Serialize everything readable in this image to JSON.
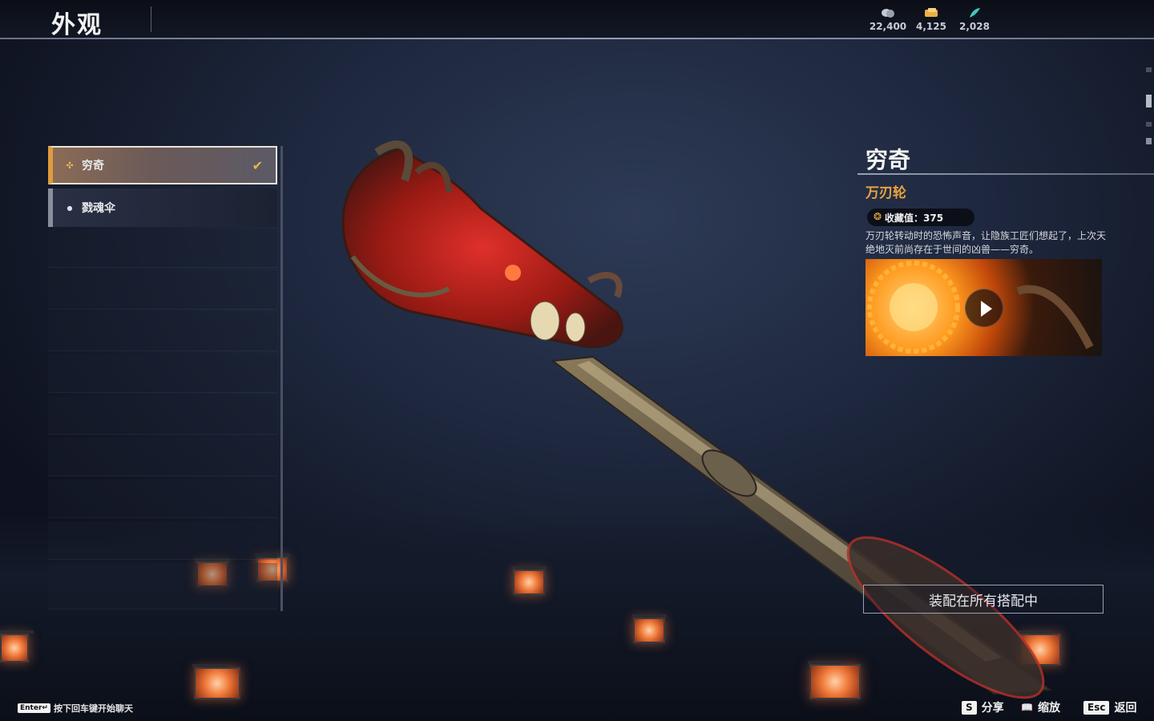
{
  "header": {
    "title": "外观",
    "currencies": [
      {
        "icon": "coin-stack-icon",
        "value": "22,400"
      },
      {
        "icon": "gold-ticket-icon",
        "value": "4,125"
      },
      {
        "icon": "jade-feather-icon",
        "value": "2,028"
      }
    ]
  },
  "sidebar": {
    "items": [
      {
        "label": "穷奇",
        "icon": "dragon-emblem-icon",
        "selected": true
      },
      {
        "label": "戮魂伞",
        "icon": "dot-icon",
        "selected": false
      }
    ]
  },
  "detail": {
    "name": "穷奇",
    "type": "万刃轮",
    "collection_label": "收藏值：375",
    "description": "万刃轮转动时的恐怖声音，让隐族工匠们想起了，上次天绝地灭前尚存在于世间的凶兽——穷奇。",
    "video_icon": "play-icon",
    "equip_label": "装配在所有搭配中"
  },
  "footer": {
    "chat_key": "Enter↵",
    "chat_label": "按下回车键开始聊天",
    "hints": [
      {
        "key": "S",
        "label": "分享"
      },
      {
        "key": "📖",
        "label": "缩放"
      },
      {
        "key": "Esc",
        "label": "返回"
      }
    ]
  },
  "colors": {
    "accent": "#e8a33e",
    "selected_border": "#e09b3e",
    "background": "#1f2940"
  }
}
